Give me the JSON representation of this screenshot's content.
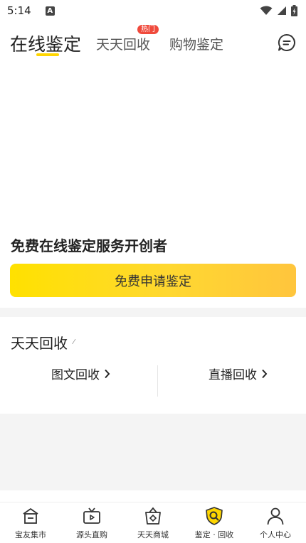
{
  "status_bar": {
    "time": "5:14",
    "badge": "A",
    "icons": [
      "wifi-icon",
      "signal-icon",
      "battery-icon"
    ]
  },
  "top_tabs": {
    "tabs": [
      {
        "label": "在线鉴定",
        "active": true
      },
      {
        "label": "天天回收",
        "active": false,
        "badge": "热门"
      },
      {
        "label": "购物鉴定",
        "active": false
      }
    ],
    "message_icon": "message-icon"
  },
  "hero": {
    "title": "免费在线鉴定服务开创者",
    "cta_label": "免费申请鉴定"
  },
  "recycle_section": {
    "title": "天天回收",
    "title_mark": "⁄",
    "links": [
      {
        "label": "图文回收",
        "icon": "chevron-right-icon"
      },
      {
        "label": "直播回收",
        "icon": "chevron-right-icon"
      }
    ]
  },
  "bottom_nav": {
    "items": [
      {
        "label": "宝友集市",
        "icon": "market-icon"
      },
      {
        "label": "源头直购",
        "icon": "tv-shop-icon"
      },
      {
        "label": "天天商城",
        "icon": "mall-bag-icon"
      },
      {
        "label": "鉴定 · 回收",
        "icon": "appraisal-shield-icon",
        "active": true
      },
      {
        "label": "个人中心",
        "icon": "person-icon"
      }
    ]
  },
  "colors": {
    "accent_yellow": "#ffd600",
    "badge_red": "#f04a3c",
    "gray_band": "#f4f4f4"
  }
}
